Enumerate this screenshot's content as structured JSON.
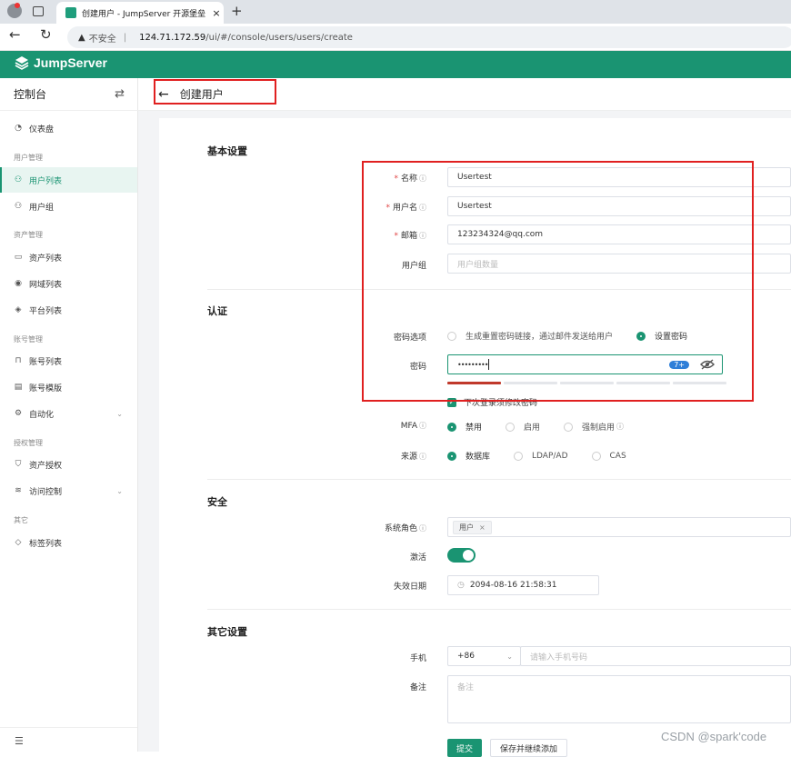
{
  "browser": {
    "tab_title": "创建用户 - JumpServer 开源堡垒",
    "tab_close": "×",
    "new_tab": "+",
    "security_label": "不安全",
    "url_host": "124.71.172.59",
    "url_path": "/ui/#/console/users/users/create"
  },
  "app": {
    "brand": "JumpServer"
  },
  "sidebar": {
    "title": "控制台",
    "swap_glyph": "⇄",
    "dashboard": "仪表盘",
    "groups": {
      "user_mgmt": "用户管理",
      "asset_mgmt": "资产管理",
      "account_mgmt": "账号管理",
      "perm_mgmt": "授权管理",
      "other": "其它"
    },
    "items": {
      "user_list": "用户列表",
      "user_group": "用户组",
      "asset_list": "资产列表",
      "domain_list": "网域列表",
      "platform_list": "平台列表",
      "account_list": "账号列表",
      "account_template": "账号模版",
      "automation": "自动化",
      "asset_perm": "资产授权",
      "access_control": "访问控制",
      "label_list": "标签列表"
    }
  },
  "page": {
    "title": "创建用户",
    "back_glyph": "←"
  },
  "form": {
    "sections": {
      "basic": "基本设置",
      "auth": "认证",
      "security": "安全",
      "other": "其它设置"
    },
    "required_mark": "*",
    "help_glyph": "ⓘ",
    "name": {
      "label": "名称",
      "value": "Usertest"
    },
    "username": {
      "label": "用户名",
      "value": "Usertest"
    },
    "email": {
      "label": "邮箱",
      "value": "123234324@qq.com"
    },
    "groups": {
      "label": "用户组",
      "placeholder": "用户组数量"
    },
    "password_option": {
      "label": "密码选项",
      "options": [
        "生成重置密码链接，通过邮件发送给用户",
        "设置密码"
      ],
      "selected": 1
    },
    "password": {
      "label": "密码",
      "masked_value": "•••••••••",
      "length_badge": "7+",
      "strength_segments": 5,
      "strength_level": 1
    },
    "force_change": {
      "label": "下次登录须修改密码",
      "checked": true
    },
    "mfa": {
      "label": "MFA",
      "options": [
        "禁用",
        "启用",
        "强制启用"
      ],
      "selected": 0
    },
    "source": {
      "label": "来源",
      "options": [
        "数据库",
        "LDAP/AD",
        "CAS"
      ],
      "selected": 0
    },
    "system_roles": {
      "label": "系统角色",
      "tag": "用户",
      "tag_close": "×"
    },
    "is_active": {
      "label": "激活",
      "on": true
    },
    "expiry": {
      "label": "失效日期",
      "value": "2094-08-16 21:58:31"
    },
    "phone": {
      "label": "手机",
      "country_code": "+86",
      "placeholder": "请输入手机号码"
    },
    "comment": {
      "label": "备注",
      "placeholder": "备注"
    },
    "buttons": {
      "submit": "提交",
      "save_continue": "保存并继续添加"
    }
  },
  "watermark": "CSDN @spark'code",
  "colors": {
    "brand": "#1a9472",
    "annotation_red": "#e02020"
  }
}
